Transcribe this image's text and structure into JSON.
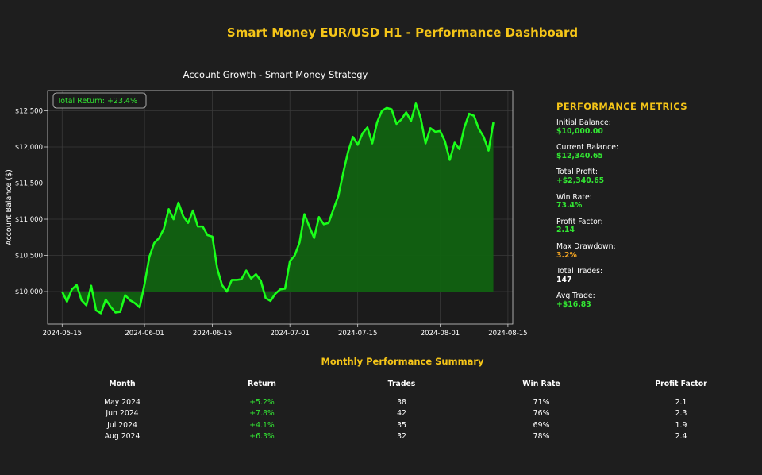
{
  "dashboard": {
    "title": "Smart Money EUR/USD H1 - Performance Dashboard"
  },
  "chart_data": {
    "type": "area",
    "title": "Account Growth - Smart Money Strategy",
    "xlabel": "",
    "ylabel": "Account Balance ($)",
    "annotation": "Total Return: +23.4%",
    "baseline": 10000,
    "xlim": [
      "2024-05-12",
      "2024-08-16"
    ],
    "ylim": [
      9550,
      12780
    ],
    "x_ticks": [
      "2024-05-15",
      "2024-06-01",
      "2024-06-15",
      "2024-07-01",
      "2024-07-15",
      "2024-08-01",
      "2024-08-15"
    ],
    "y_ticks": [
      {
        "value": 10000,
        "label": "$10,000"
      },
      {
        "value": 10500,
        "label": "$10,500"
      },
      {
        "value": 11000,
        "label": "$11,000"
      },
      {
        "value": 11500,
        "label": "$11,500"
      },
      {
        "value": 12000,
        "label": "$12,000"
      },
      {
        "value": 12500,
        "label": "$12,500"
      }
    ],
    "grid": true,
    "line_color": "#1aff1a",
    "fill_color": "#116211",
    "series": [
      {
        "values": [
          [
            "2024-05-15",
            10000
          ],
          [
            "2024-05-16",
            9860
          ],
          [
            "2024-05-17",
            10030
          ],
          [
            "2024-05-18",
            10090
          ],
          [
            "2024-05-19",
            9880
          ],
          [
            "2024-05-20",
            9810
          ],
          [
            "2024-05-21",
            10080
          ],
          [
            "2024-05-22",
            9740
          ],
          [
            "2024-05-23",
            9700
          ],
          [
            "2024-05-24",
            9890
          ],
          [
            "2024-05-25",
            9790
          ],
          [
            "2024-05-26",
            9710
          ],
          [
            "2024-05-27",
            9720
          ],
          [
            "2024-05-28",
            9950
          ],
          [
            "2024-05-29",
            9880
          ],
          [
            "2024-05-30",
            9840
          ],
          [
            "2024-05-31",
            9780
          ],
          [
            "2024-06-01",
            10100
          ],
          [
            "2024-06-02",
            10480
          ],
          [
            "2024-06-03",
            10670
          ],
          [
            "2024-06-04",
            10740
          ],
          [
            "2024-06-05",
            10870
          ],
          [
            "2024-06-06",
            11140
          ],
          [
            "2024-06-07",
            11000
          ],
          [
            "2024-06-08",
            11230
          ],
          [
            "2024-06-09",
            11040
          ],
          [
            "2024-06-10",
            10950
          ],
          [
            "2024-06-11",
            11120
          ],
          [
            "2024-06-12",
            10900
          ],
          [
            "2024-06-13",
            10900
          ],
          [
            "2024-06-14",
            10780
          ],
          [
            "2024-06-15",
            10760
          ],
          [
            "2024-06-16",
            10320
          ],
          [
            "2024-06-17",
            10090
          ],
          [
            "2024-06-18",
            10000
          ],
          [
            "2024-06-19",
            10160
          ],
          [
            "2024-06-20",
            10160
          ],
          [
            "2024-06-21",
            10170
          ],
          [
            "2024-06-22",
            10290
          ],
          [
            "2024-06-23",
            10180
          ],
          [
            "2024-06-24",
            10240
          ],
          [
            "2024-06-25",
            10150
          ],
          [
            "2024-06-26",
            9910
          ],
          [
            "2024-06-27",
            9870
          ],
          [
            "2024-06-28",
            9970
          ],
          [
            "2024-06-29",
            10030
          ],
          [
            "2024-06-30",
            10040
          ],
          [
            "2024-07-01",
            10420
          ],
          [
            "2024-07-02",
            10500
          ],
          [
            "2024-07-03",
            10680
          ],
          [
            "2024-07-04",
            11070
          ],
          [
            "2024-07-05",
            10900
          ],
          [
            "2024-07-06",
            10740
          ],
          [
            "2024-07-07",
            11030
          ],
          [
            "2024-07-08",
            10930
          ],
          [
            "2024-07-09",
            10950
          ],
          [
            "2024-07-10",
            11140
          ],
          [
            "2024-07-11",
            11320
          ],
          [
            "2024-07-12",
            11640
          ],
          [
            "2024-07-13",
            11930
          ],
          [
            "2024-07-14",
            12140
          ],
          [
            "2024-07-15",
            12030
          ],
          [
            "2024-07-16",
            12190
          ],
          [
            "2024-07-17",
            12270
          ],
          [
            "2024-07-18",
            12050
          ],
          [
            "2024-07-19",
            12340
          ],
          [
            "2024-07-20",
            12500
          ],
          [
            "2024-07-21",
            12540
          ],
          [
            "2024-07-22",
            12520
          ],
          [
            "2024-07-23",
            12320
          ],
          [
            "2024-07-24",
            12380
          ],
          [
            "2024-07-25",
            12480
          ],
          [
            "2024-07-26",
            12360
          ],
          [
            "2024-07-27",
            12600
          ],
          [
            "2024-07-28",
            12400
          ],
          [
            "2024-07-29",
            12050
          ],
          [
            "2024-07-30",
            12260
          ],
          [
            "2024-07-31",
            12210
          ],
          [
            "2024-08-01",
            12220
          ],
          [
            "2024-08-02",
            12080
          ],
          [
            "2024-08-03",
            11820
          ],
          [
            "2024-08-04",
            12060
          ],
          [
            "2024-08-05",
            11970
          ],
          [
            "2024-08-06",
            12270
          ],
          [
            "2024-08-07",
            12460
          ],
          [
            "2024-08-08",
            12430
          ],
          [
            "2024-08-09",
            12250
          ],
          [
            "2024-08-10",
            12140
          ],
          [
            "2024-08-11",
            11950
          ],
          [
            "2024-08-12",
            12340
          ]
        ]
      }
    ]
  },
  "metrics": {
    "heading": "PERFORMANCE METRICS",
    "items": [
      {
        "label": "Initial Balance:",
        "value": "$10,000.00",
        "color": "#33e633"
      },
      {
        "label": "Current Balance:",
        "value": "$12,340.65",
        "color": "#33e633"
      },
      {
        "label": "Total Profit:",
        "value": "+$2,340.65",
        "color": "#33e633"
      },
      {
        "label": "Win Rate:",
        "value": "73.4%",
        "color": "#33e633"
      },
      {
        "label": "Profit Factor:",
        "value": "2.14",
        "color": "#33e633"
      },
      {
        "label": "Max Drawdown:",
        "value": "3.2%",
        "color": "#f5a623"
      },
      {
        "label": "Total Trades:",
        "value": "147",
        "color": "#ffffff"
      },
      {
        "label": "Avg Trade:",
        "value": "+$16.83",
        "color": "#33e633"
      }
    ]
  },
  "summary": {
    "title": "Monthly Performance Summary",
    "headers": [
      "Month",
      "Return",
      "Trades",
      "Win Rate",
      "Profit Factor"
    ],
    "rows": [
      [
        "May 2024",
        "+5.2%",
        "38",
        "71%",
        "2.1"
      ],
      [
        "Jun 2024",
        "+7.8%",
        "42",
        "76%",
        "2.3"
      ],
      [
        "Jul 2024",
        "+4.1%",
        "35",
        "69%",
        "1.9"
      ],
      [
        "Aug 2024",
        "+6.3%",
        "32",
        "78%",
        "2.4"
      ]
    ]
  }
}
